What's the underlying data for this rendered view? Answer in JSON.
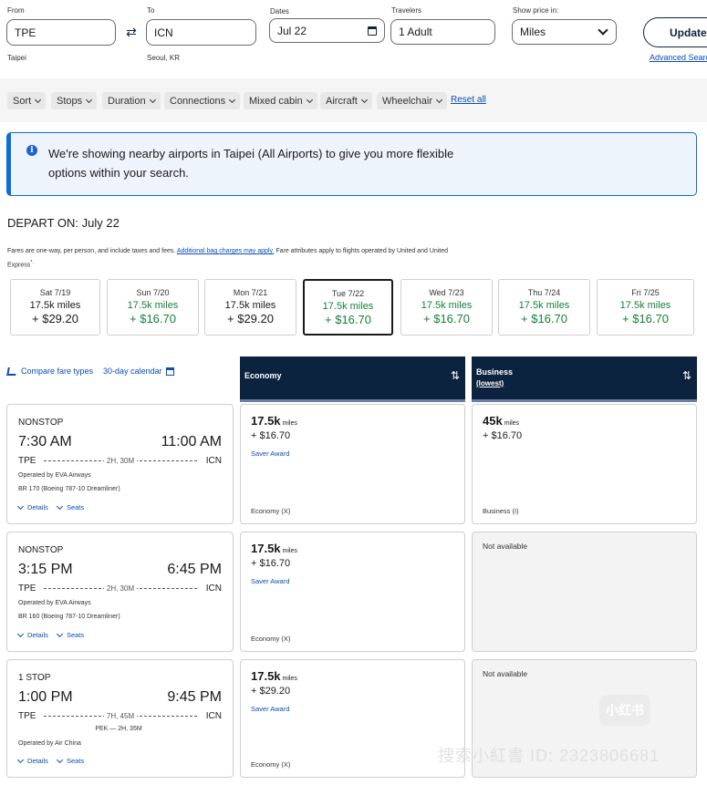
{
  "search": {
    "from_label": "From",
    "from_value": "TPE",
    "from_sub": "Taipei",
    "to_label": "To",
    "to_value": "ICN",
    "to_sub": "Seoul, KR",
    "dates_label": "Dates",
    "dates_value": "Jul 22",
    "travelers_label": "Travelers",
    "travelers_value": "1 Adult",
    "price_label": "Show price in:",
    "price_value": "Miles",
    "update_label": "Update",
    "advanced_label": "Advanced Search"
  },
  "filters": {
    "items": [
      "Sort",
      "Stops",
      "Duration",
      "Connections",
      "Mixed cabin",
      "Aircraft",
      "Wheelchair"
    ],
    "reset_label": "Reset all"
  },
  "banner": {
    "text": "We're showing nearby airports in Taipei (All Airports) to give you more flexible options within your search."
  },
  "depart": {
    "title": "DEPART ON: July 22",
    "note_pre": "Fares are one-way, per person, and include taxes and fees. ",
    "note_link": "Additional bag charges may apply.",
    "note_post": " Fare attributes apply to flights operated by United and United Express",
    "note_mark": "*."
  },
  "dates": [
    {
      "day": "Sat 7/19",
      "miles": "17.5k miles",
      "price": "+ $29.20"
    },
    {
      "day": "Sun 7/20",
      "miles": "17.5k miles",
      "price": "+ $16.70"
    },
    {
      "day": "Mon 7/21",
      "miles": "17.5k miles",
      "price": "+ $29.20"
    },
    {
      "day": "Tue 7/22",
      "miles": "17.5k miles",
      "price": "+ $16.70"
    },
    {
      "day": "Wed 7/23",
      "miles": "17.5k miles",
      "price": "+ $16.70"
    },
    {
      "day": "Thu 7/24",
      "miles": "17.5k miles",
      "price": "+ $16.70"
    },
    {
      "day": "Fri 7/25",
      "miles": "17.5k miles",
      "price": "+ $16.70"
    }
  ],
  "compare": {
    "fare_types_label": "Compare fare types",
    "calendar_label": "30-day calendar"
  },
  "cabins": {
    "economy": "Economy",
    "business": "Business",
    "business_sub": "(lowest)"
  },
  "flights": [
    {
      "stops": "NONSTOP",
      "dep_time": "7:30 AM",
      "arr_time": "11:00 AM",
      "from": "TPE",
      "to": "ICN",
      "duration": "2H, 30M",
      "connection": "",
      "operator": "Operated by EVA Airways",
      "equipment": "BR 170 (Boeing 787-10 Dreamliner)",
      "details": "Details",
      "seats": "Seats",
      "economy": {
        "miles": "17.5k",
        "unit": "miles",
        "tax": "+ $16.70",
        "award": "Saver Award",
        "class": "Economy (X)"
      },
      "business": {
        "available": true,
        "miles": "45k",
        "unit": "miles",
        "tax": "+ $16.70",
        "class": "Business (I)",
        "na": ""
      }
    },
    {
      "stops": "NONSTOP",
      "dep_time": "3:15 PM",
      "arr_time": "6:45 PM",
      "from": "TPE",
      "to": "ICN",
      "duration": "2H, 30M",
      "connection": "",
      "operator": "Operated by EVA Airways",
      "equipment": "BR 160 (Boeing 787-10 Dreamliner)",
      "details": "Details",
      "seats": "Seats",
      "economy": {
        "miles": "17.5k",
        "unit": "miles",
        "tax": "+ $16.70",
        "award": "Saver Award",
        "class": "Economy (X)"
      },
      "business": {
        "available": false,
        "miles": "",
        "unit": "",
        "tax": "",
        "class": "",
        "na": "Not available"
      }
    },
    {
      "stops": "1 STOP",
      "dep_time": "1:00 PM",
      "arr_time": "9:45 PM",
      "from": "TPE",
      "to": "ICN",
      "duration": "7H, 45M",
      "connection": "PEK — 2H, 35M",
      "operator": "Operated by Air China",
      "equipment": "",
      "details": "Details",
      "seats": "Seats",
      "economy": {
        "miles": "17.5k",
        "unit": "miles",
        "tax": "+ $29.20",
        "award": "Saver Award",
        "class": "Economy (X)"
      },
      "business": {
        "available": false,
        "miles": "",
        "unit": "",
        "tax": "",
        "class": "",
        "na": "Not available"
      }
    }
  ],
  "watermark": {
    "text": "搜索小紅書 ID: 2323806681",
    "logo": "小红书"
  },
  "colors": {
    "navy": "#0c2340",
    "link_blue": "#0b4db5",
    "price_green": "#15803d",
    "banner_border": "#0b6ed6"
  }
}
